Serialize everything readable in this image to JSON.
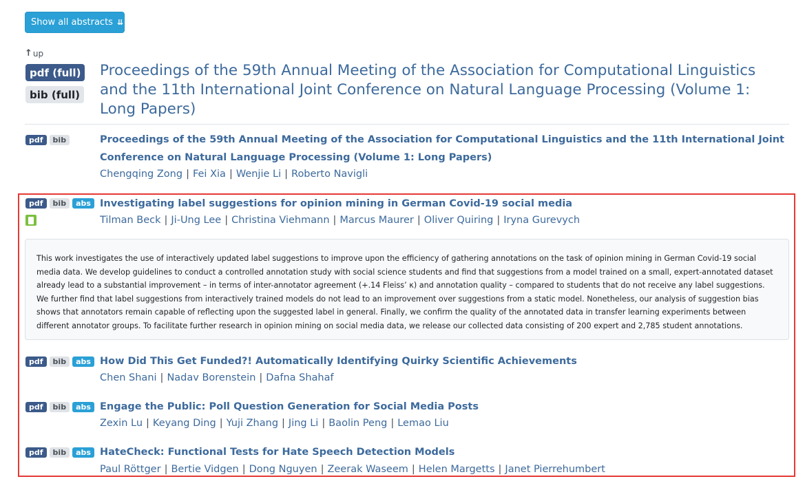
{
  "toolbar": {
    "show_all_label": "Show all abstracts",
    "show_all_icon": "double-chevron-down-icon"
  },
  "up_link": {
    "label": "up",
    "icon": "arrow-up-icon"
  },
  "volume": {
    "pdf_label": "pdf (full)",
    "bib_label": "bib (full)",
    "title": "Proceedings of the 59th Annual Meeting of the Association for Computational Linguistics and the 11th International Joint Conference on Natural Language Processing (Volume 1: Long Papers)"
  },
  "badge_labels": {
    "pdf": "pdf",
    "bib": "bib",
    "abs": "abs"
  },
  "papers": [
    {
      "title_line1": "Proceedings of the 59th Annual Meeting of the Association for Computational Linguistics and the 11th International Joint",
      "title_line2": "Conference on Natural Language Processing (Volume 1: Long Papers)",
      "authors": [
        "Chengqing Zong",
        "Fei Xia",
        "Wenjie Li",
        "Roberto Navigli"
      ]
    },
    {
      "title": "Investigating label suggestions for opinion mining in German Covid-19 social media",
      "authors": [
        "Tilman Beck",
        "Ji-Ung Lee",
        "Christina Viehmann",
        "Marcus Maurer",
        "Oliver Quiring",
        "Iryna Gurevych"
      ],
      "abstract_lines": [
        "This work investigates the use of interactively updated label suggestions to improve upon the efficiency of gathering annotations on the task of opinion mining in German Covid-19 social",
        "media data. We develop guidelines to conduct a controlled annotation study with social science students and find that suggestions from a model trained on a small, expert-annotated dataset",
        "already lead to a substantial improvement – in terms of inter-annotator agreement (+.14 Fleiss’ κ) and annotation quality – compared to students that do not receive any label suggestions.",
        "We further find that label suggestions from interactively trained models do not lead to an improvement over suggestions from a static model. Nonetheless, our analysis of suggestion bias",
        "shows that annotators remain capable of reflecting upon the suggested label in general. Finally, we confirm the quality of the annotated data in transfer learning experiments between",
        "different annotator groups. To facilitate further research in opinion mining on social media data, we release our collected data consisting of 200 expert and 2,785 student annotations."
      ]
    },
    {
      "title": "How Did This Get Funded?! Automatically Identifying Quirky Scientific Achievements",
      "authors": [
        "Chen Shani",
        "Nadav Borenstein",
        "Dafna Shahaf"
      ]
    },
    {
      "title": "Engage the Public: Poll Question Generation for Social Media Posts",
      "authors": [
        "Zexin Lu",
        "Keyang Ding",
        "Yuji Zhang",
        "Jing Li",
        "Baolin Peng",
        "Lemao Liu"
      ]
    },
    {
      "title": "HateCheck: Functional Tests for Hate Speech Detection Models",
      "authors": [
        "Paul Röttger",
        "Bertie Vidgen",
        "Dong Nguyen",
        "Zeerak Waseem",
        "Helen Margetts",
        "Janet Pierrehumbert"
      ]
    }
  ],
  "colors": {
    "link": "#3d6a9c",
    "pdf_badge": "#3c5a8a",
    "abs_badge": "#2aa0d6",
    "highlight": "#e53935"
  }
}
